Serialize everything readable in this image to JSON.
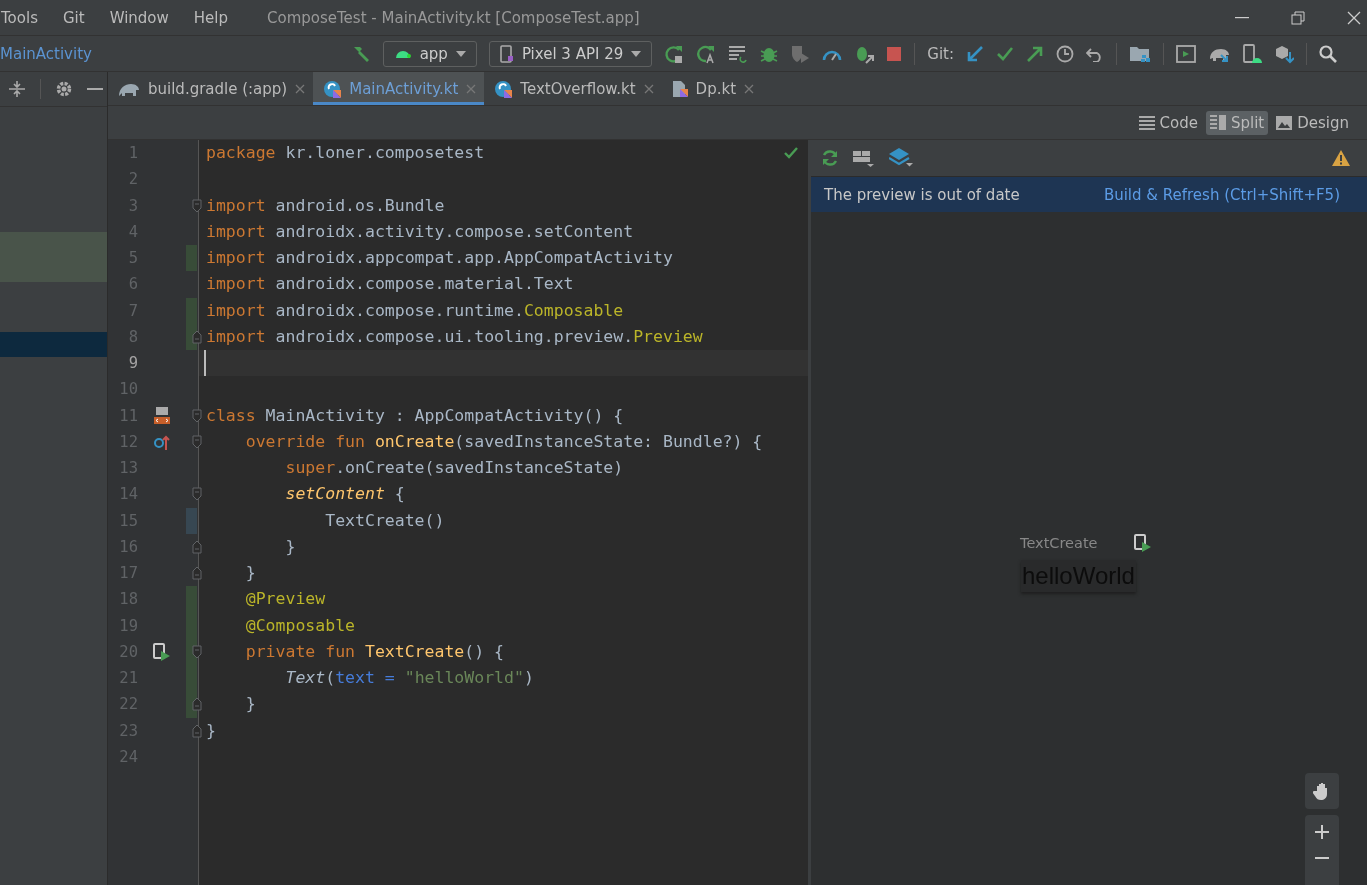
{
  "menu_bar": {
    "menus": [
      "Tools",
      "Git",
      "Window",
      "Help"
    ],
    "title": "ComposeTest - MainActivity.kt [ComposeTest.app]"
  },
  "toolbar": {
    "breadcrumb": "MainActivity",
    "run_config": "app",
    "device": "Pixel 3 API 29",
    "git_label": "Git:"
  },
  "tabs": [
    {
      "label": "build.gradle (:app)",
      "selected": false,
      "kind": "gradle"
    },
    {
      "label": "MainActivity.kt",
      "selected": true,
      "kind": "kotlin"
    },
    {
      "label": "TextOverflow.kt",
      "selected": false,
      "kind": "kotlin"
    },
    {
      "label": "Dp.kt",
      "selected": false,
      "kind": "file"
    }
  ],
  "view_modes": [
    {
      "label": "Code",
      "selected": false,
      "kind": "code"
    },
    {
      "label": "Split",
      "selected": true,
      "kind": "split"
    },
    {
      "label": "Design",
      "selected": false,
      "kind": "design"
    }
  ],
  "editor": {
    "lines": [
      {
        "number": "1",
        "tokens": [
          {
            "kind": "kw",
            "text": "package"
          },
          {
            "kind": "plain",
            "text": " kr.loner.composetest"
          }
        ]
      },
      {
        "number": "2"
      },
      {
        "number": "3",
        "fold_start": true,
        "tokens": [
          {
            "kind": "kw",
            "text": "import"
          },
          {
            "kind": "plain",
            "text": " android.os.Bundle"
          }
        ]
      },
      {
        "number": "4",
        "tokens": [
          {
            "kind": "kw",
            "text": "import"
          },
          {
            "kind": "plain",
            "text": " androidx.activity.compose.setContent"
          }
        ]
      },
      {
        "number": "5",
        "added": true,
        "tokens": [
          {
            "kind": "kw",
            "text": "import"
          },
          {
            "kind": "plain",
            "text": " androidx.appcompat.app.AppCompatActivity"
          }
        ]
      },
      {
        "number": "6",
        "tokens": [
          {
            "kind": "kw",
            "text": "import"
          },
          {
            "kind": "plain",
            "text": " androidx.compose.material.Text"
          }
        ]
      },
      {
        "number": "7",
        "added": true,
        "tokens": [
          {
            "kind": "kw",
            "text": "import"
          },
          {
            "kind": "plain",
            "text": " androidx.compose.runtime."
          },
          {
            "kind": "ann",
            "text": "Composable"
          }
        ]
      },
      {
        "number": "8",
        "added": true,
        "fold_end": true,
        "tokens": [
          {
            "kind": "kw",
            "text": "import"
          },
          {
            "kind": "plain",
            "text": " androidx.compose.ui.tooling.preview."
          },
          {
            "kind": "ann",
            "text": "Preview"
          }
        ]
      },
      {
        "number": "9",
        "current": true
      },
      {
        "number": "10"
      },
      {
        "number": "11",
        "fold_start": true,
        "gutter_icon": {
          "kind": "layout"
        },
        "tokens": [
          {
            "kind": "kw",
            "text": "class"
          },
          {
            "kind": "plain",
            "text": " MainActivity : AppCompatActivity() {"
          }
        ]
      },
      {
        "number": "12",
        "fold_start": true,
        "gutter_icon": {
          "kind": "override"
        },
        "tokens": [
          {
            "kind": "kw",
            "text": "    override fun"
          },
          {
            "kind": "fn",
            "text": " onCreate"
          },
          {
            "kind": "plain",
            "text": "(savedInstanceState: Bundle?) {"
          }
        ]
      },
      {
        "number": "13",
        "tokens": [
          {
            "kind": "kw",
            "text": "        super"
          },
          {
            "kind": "plain",
            "text": ".onCreate(savedInstanceState)"
          }
        ]
      },
      {
        "number": "14",
        "fold_start": true,
        "tokens": [
          {
            "kind": "fn-italic",
            "text": "        setContent"
          },
          {
            "kind": "plain",
            "text": " {"
          }
        ]
      },
      {
        "number": "15",
        "modified": true,
        "tokens": [
          {
            "kind": "plain",
            "text": "            TextCreate()"
          }
        ]
      },
      {
        "number": "16",
        "fold_end": true,
        "tokens": [
          {
            "kind": "plain",
            "text": "        }"
          }
        ]
      },
      {
        "number": "17",
        "fold_end": true,
        "tokens": [
          {
            "kind": "plain",
            "text": "    }"
          }
        ]
      },
      {
        "number": "18",
        "added": true,
        "tokens": [
          {
            "kind": "ann",
            "text": "    @Preview"
          }
        ]
      },
      {
        "number": "19",
        "added": true,
        "tokens": [
          {
            "kind": "ann",
            "text": "    @Composable"
          }
        ]
      },
      {
        "number": "20",
        "added": true,
        "fold_start": true,
        "gutter_icon": {
          "kind": "run-preview"
        },
        "tokens": [
          {
            "kind": "kw",
            "text": "    private fun"
          },
          {
            "kind": "fn",
            "text": " TextCreate"
          },
          {
            "kind": "plain",
            "text": "() {"
          }
        ]
      },
      {
        "number": "21",
        "added": true,
        "tokens": [
          {
            "kind": "call-italic",
            "text": "        Text"
          },
          {
            "kind": "plain",
            "text": "("
          },
          {
            "kind": "param",
            "text": "text = "
          },
          {
            "kind": "str",
            "text": "\"helloWorld\""
          },
          {
            "kind": "plain",
            "text": ")"
          }
        ]
      },
      {
        "number": "22",
        "added": true,
        "fold_end": true,
        "tokens": [
          {
            "kind": "plain",
            "text": "    }"
          }
        ]
      },
      {
        "number": "23",
        "fold_end": true,
        "tokens": [
          {
            "kind": "plain",
            "text": "}"
          }
        ]
      },
      {
        "number": "24"
      }
    ]
  },
  "preview": {
    "banner": "The preview is out of date",
    "action": "Build & Refresh (Ctrl+Shift+F5)",
    "component_name": "TextCreate",
    "rendered_text": "helloWorld"
  }
}
